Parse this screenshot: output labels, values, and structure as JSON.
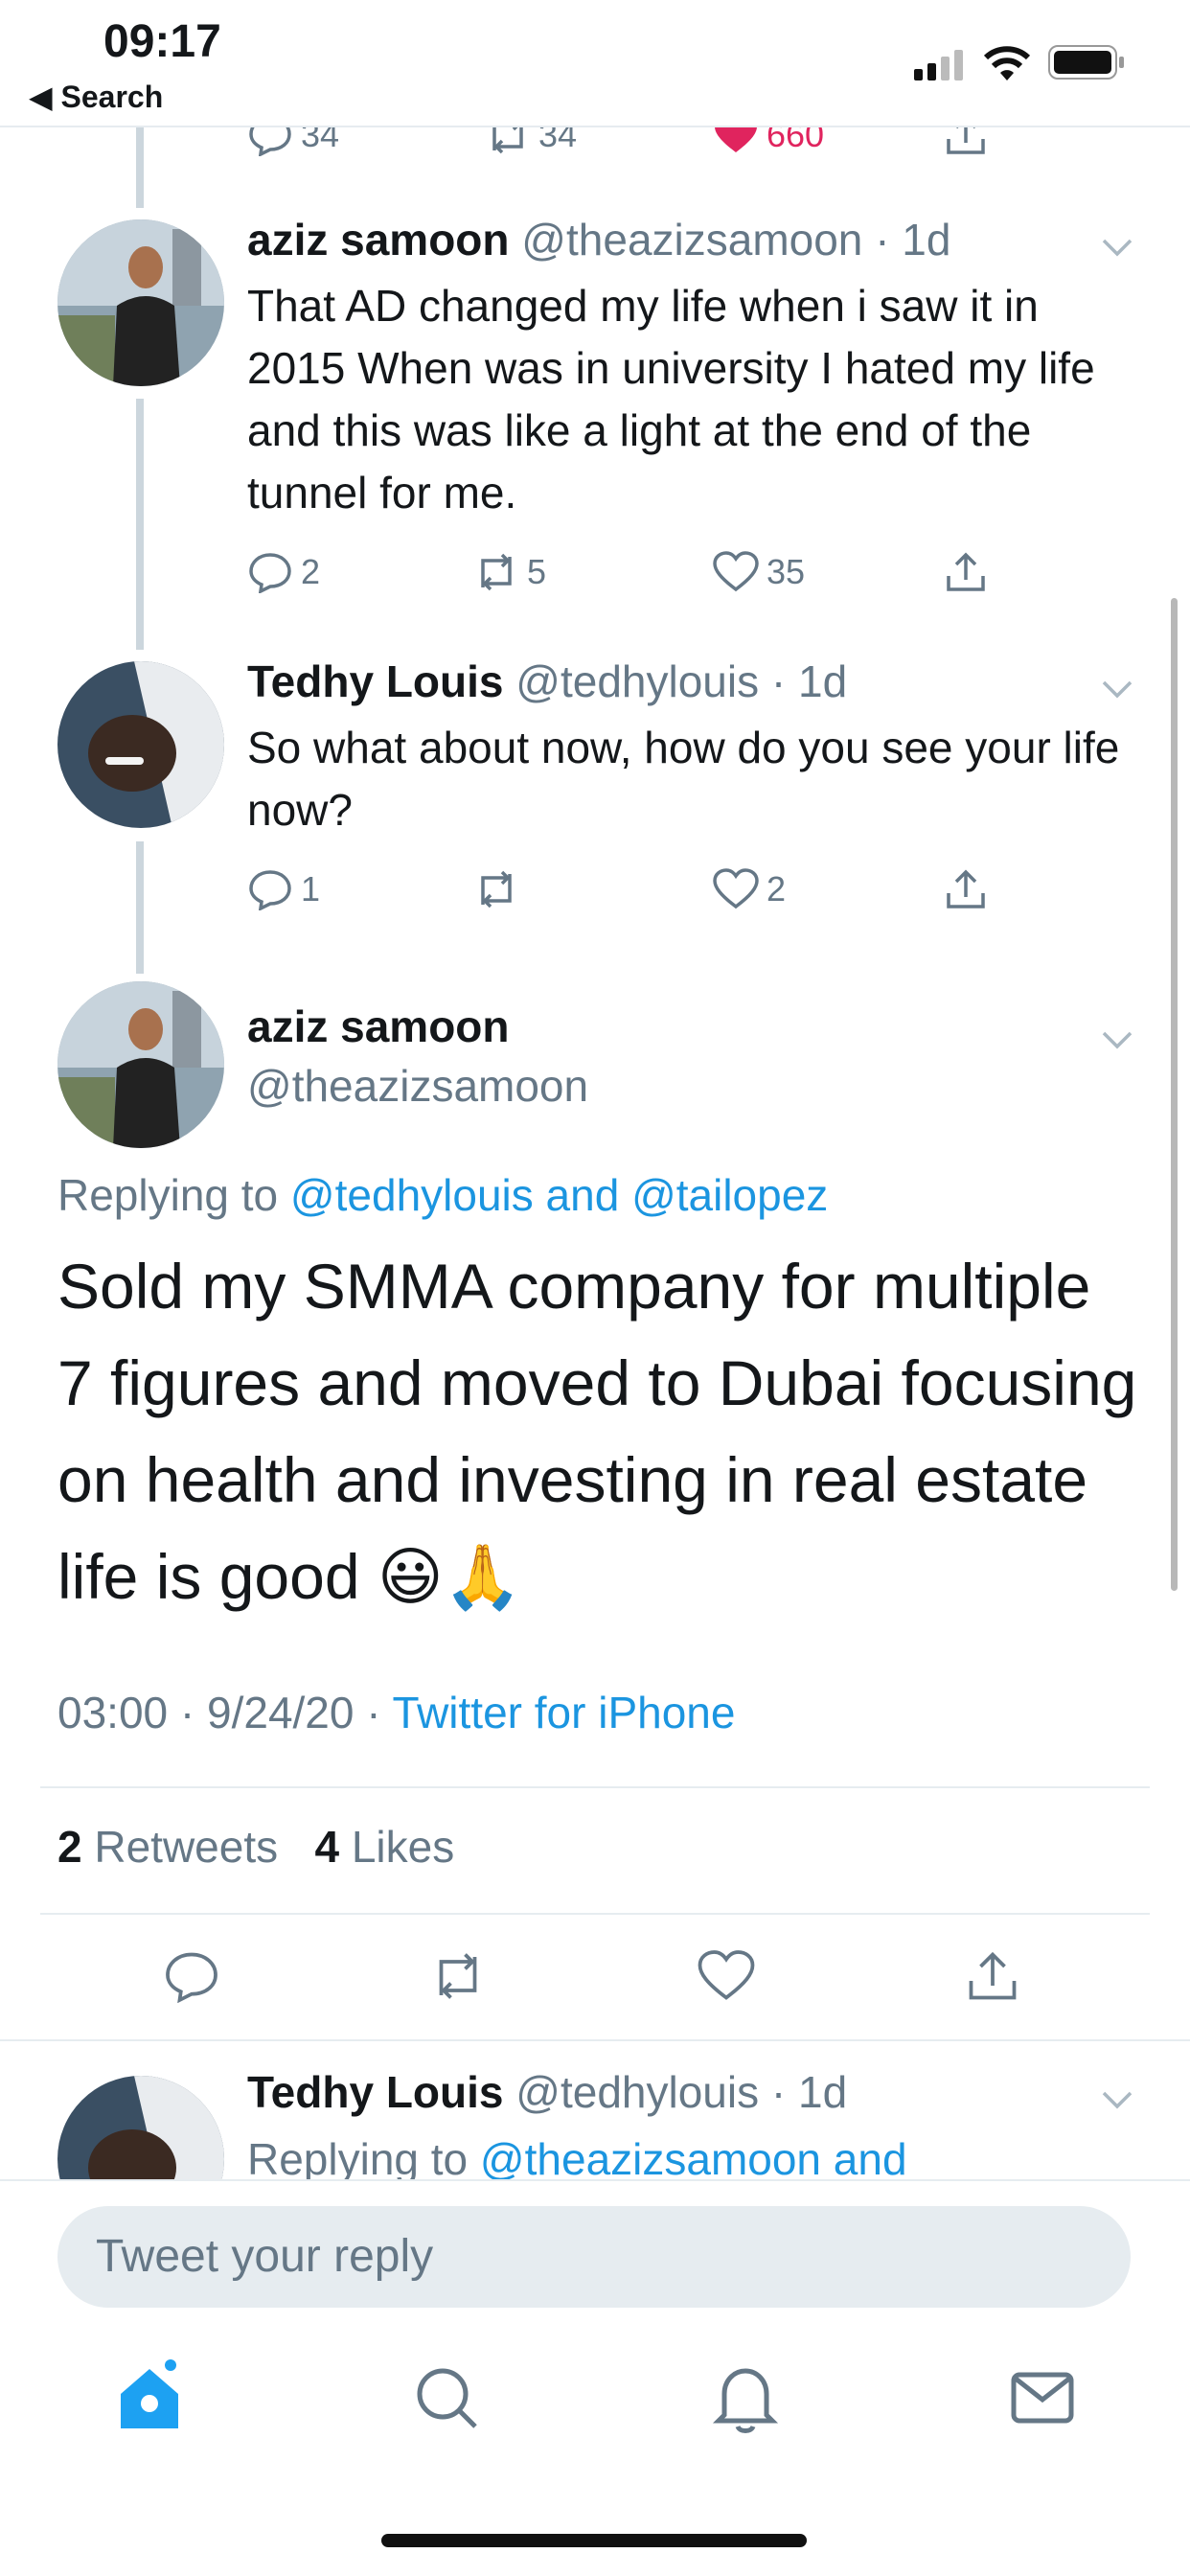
{
  "status_bar": {
    "time": "09:17",
    "back_label": "◀ Search"
  },
  "colors": {
    "accent": "#1b95e0",
    "like": "#e0245e",
    "muted": "#657786",
    "text": "#14171a"
  },
  "top_partial": {
    "replies": "34",
    "retweets": "34",
    "likes": "660"
  },
  "tweets": [
    {
      "name": "aziz samoon",
      "handle": "@theazizsamoon",
      "dot_time": "· 1d",
      "text": "That AD changed my life when i saw it in 2015 When was in university I hated my life and this was like a light at the end of the tunnel for me.",
      "replies": "2",
      "retweets": "5",
      "likes": "35"
    },
    {
      "name": "Tedhy Louis",
      "handle": "@tedhylouis",
      "dot_time": "· 1d",
      "text": "So what about now, how do you see your life now?",
      "replies": "1",
      "retweets": "",
      "likes": "2"
    }
  ],
  "main_tweet": {
    "name": "aziz samoon",
    "handle": "@theazizsamoon",
    "replying_prefix": "Replying to",
    "replying_to": "@tedhylouis and @tailopez",
    "text": "Sold my SMMA company for multiple 7 figures and moved to Dubai focusing on health and investing in real estate life is good 😃🙏",
    "time": "03:00 · 9/24/20 · ",
    "source": "Twitter for iPhone",
    "retweet_count": "2",
    "retweet_label": "Retweets",
    "like_count": "4",
    "like_label": "Likes"
  },
  "next_tweet": {
    "name": "Tedhy Louis",
    "handle": "@tedhylouis",
    "dot_time": "· 1d",
    "replying_prefix": "Replying to",
    "replying_to": "@theazizsamoon and"
  },
  "reply": {
    "placeholder": "Tweet your reply"
  },
  "tabbar": {
    "icons": [
      "home-icon",
      "search-icon",
      "notifications-icon",
      "messages-icon"
    ]
  }
}
